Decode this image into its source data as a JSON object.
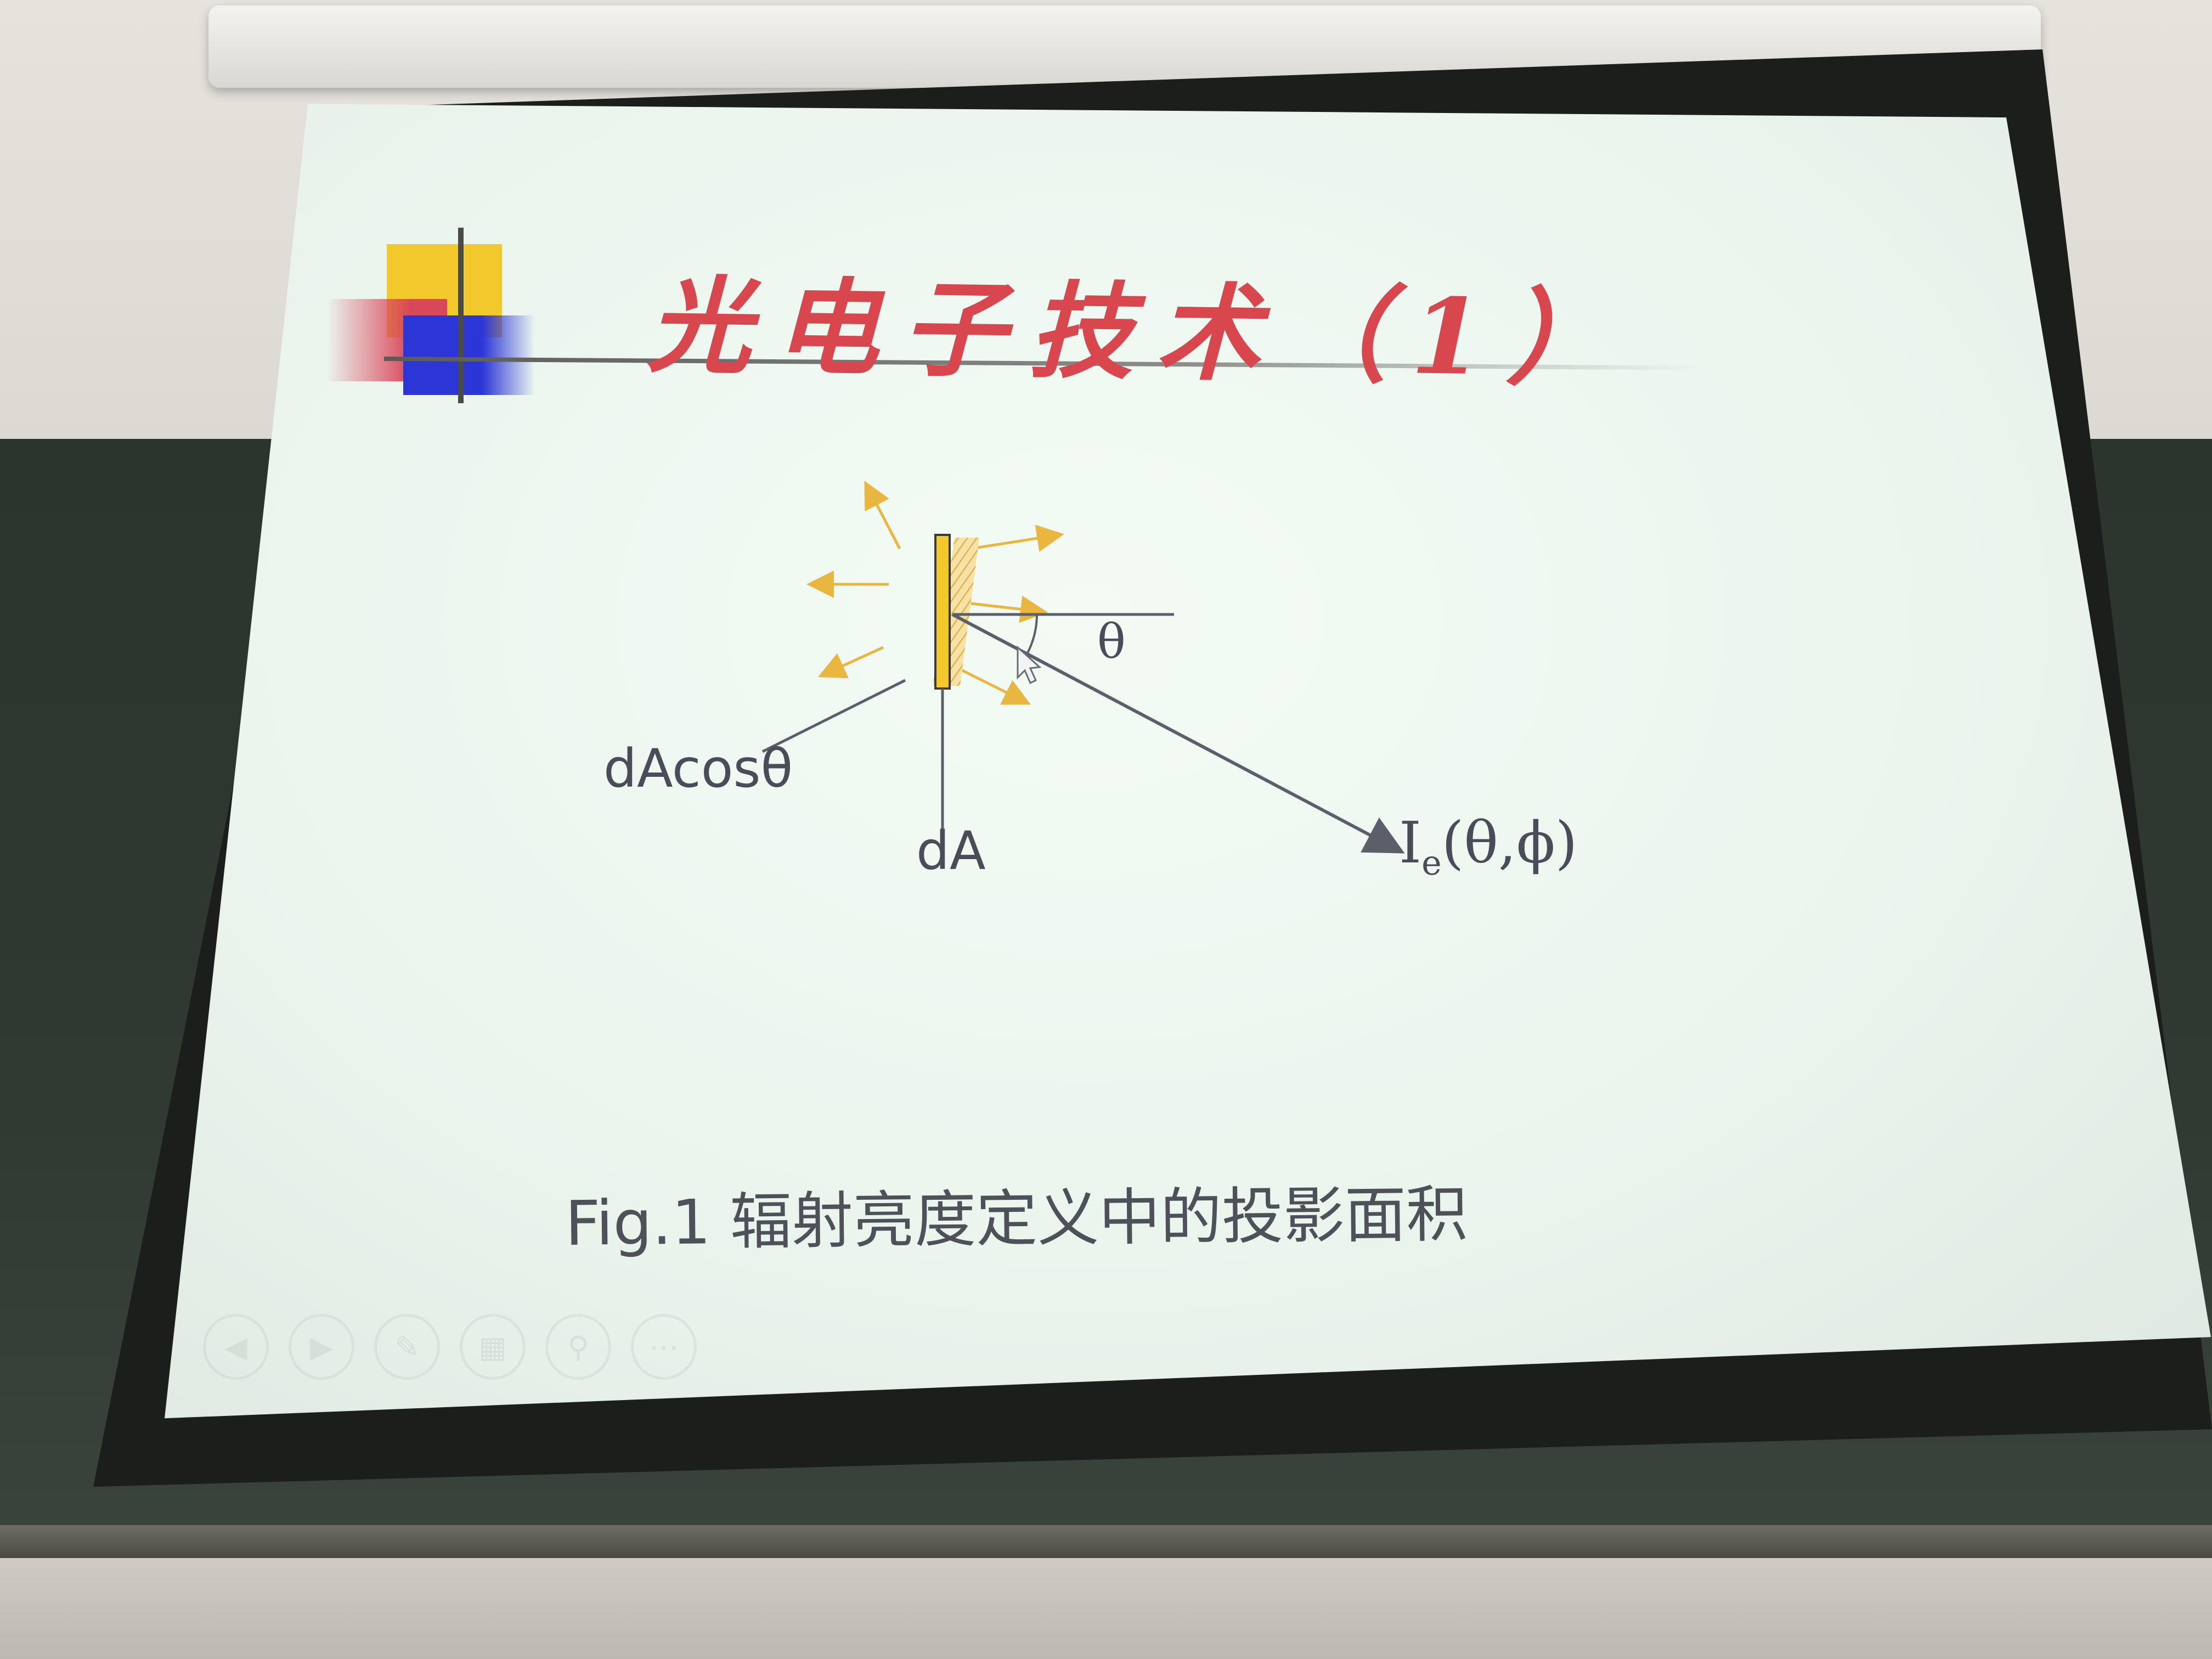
{
  "slide": {
    "title": "光电子技术（1）",
    "caption": "Fig.1 辐射亮度定义中的投影面积"
  },
  "diagram": {
    "label_projected": "dAcosθ",
    "label_area": "dA",
    "label_intensity_main": "I",
    "label_intensity_sub": "e",
    "label_intensity_args": "(θ,ϕ)",
    "label_angle": "θ"
  },
  "player_controls": [
    {
      "name": "previous",
      "glyph": "◀"
    },
    {
      "name": "next",
      "glyph": "▶"
    },
    {
      "name": "pen",
      "glyph": "✎"
    },
    {
      "name": "slides",
      "glyph": "▦"
    },
    {
      "name": "zoom",
      "glyph": "⚲"
    },
    {
      "name": "more",
      "glyph": "⋯"
    }
  ],
  "colors": {
    "title": "#d8474e",
    "accent_yellow": "#f2c82a",
    "accent_blue": "#2c36d6",
    "accent_red": "#d9475a",
    "diagram_lines": "#5b5f6a",
    "emission_arrows": "#e9b640"
  }
}
